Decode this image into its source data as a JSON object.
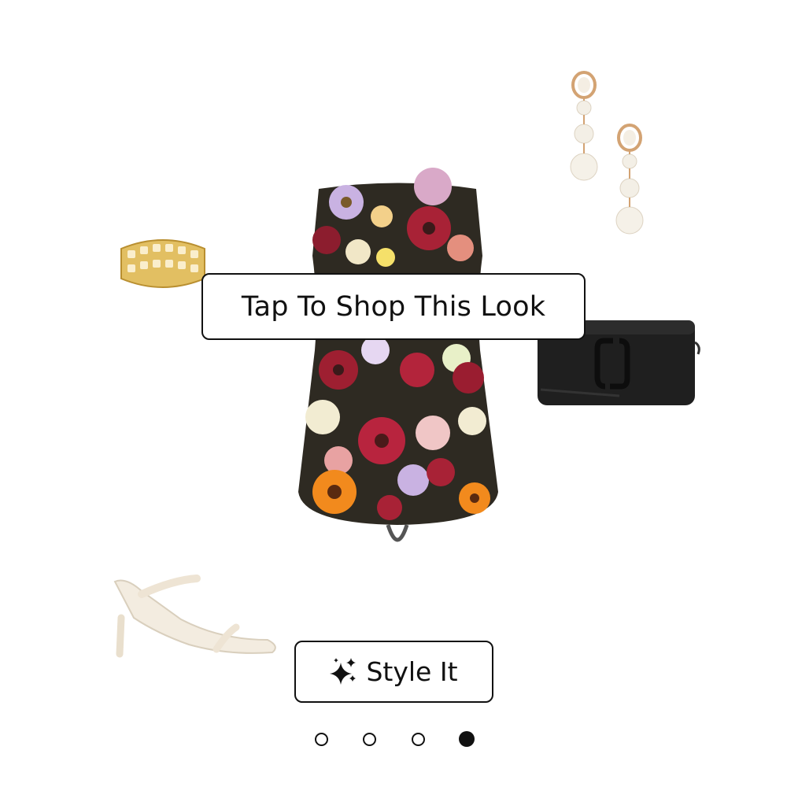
{
  "look": {
    "items": [
      {
        "name": "floral strapless mini dress"
      },
      {
        "name": "pearl drop earrings"
      },
      {
        "name": "gold chain link cuff bracelet"
      },
      {
        "name": "black leather crossbody bag"
      },
      {
        "name": "white strappy heeled sandal"
      }
    ]
  },
  "overlay": {
    "shop_label": "Tap To Shop This Look"
  },
  "actions": {
    "style_label": "Style It",
    "style_icon": "sparkles-icon"
  },
  "pagination": {
    "total": 4,
    "active_index": 3
  },
  "colors": {
    "text": "#111111",
    "background": "#ffffff"
  }
}
